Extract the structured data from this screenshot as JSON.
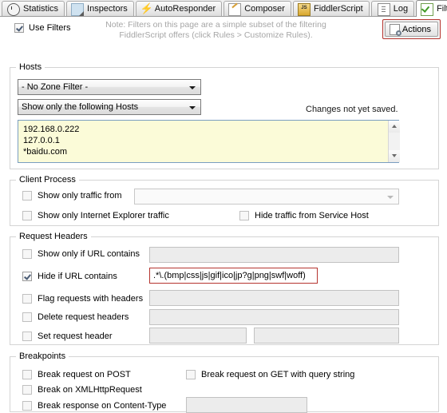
{
  "tabs": [
    {
      "label": "Statistics",
      "icon": "stopwatch-icon",
      "active": false
    },
    {
      "label": "Inspectors",
      "icon": "inspectors-icon",
      "active": false
    },
    {
      "label": "AutoResponder",
      "icon": "lightning-icon",
      "active": false
    },
    {
      "label": "Composer",
      "icon": "compose-icon",
      "active": false
    },
    {
      "label": "FiddlerScript",
      "icon": "js-script-icon",
      "active": false
    },
    {
      "label": "Log",
      "icon": "log-icon",
      "active": false
    },
    {
      "label": "Filters",
      "icon": "filter-check-icon",
      "active": true
    }
  ],
  "toolbar": {
    "use_filters_label": "Use Filters",
    "use_filters_checked": true,
    "note_line1": "Note: Filters on this page are a simple subset of the filtering",
    "note_line2": "FiddlerScript offers (click Rules > Customize Rules).",
    "actions_label": "Actions"
  },
  "hosts": {
    "legend": "Hosts",
    "zone_filter_value": "- No Zone Filter -",
    "host_mode_value": "Show only the following Hosts",
    "host_list": "192.168.0.222\n127.0.0.1\n*baidu.com",
    "status_text": "Changes not yet saved."
  },
  "client_process": {
    "legend": "Client Process",
    "show_only_traffic_from_label": "Show only traffic from",
    "show_only_traffic_from_checked": false,
    "process_value": "",
    "show_only_ie_label": "Show only Internet Explorer traffic",
    "show_only_ie_checked": false,
    "hide_service_host_label": "Hide traffic from Service Host",
    "hide_service_host_checked": false
  },
  "request_headers": {
    "legend": "Request Headers",
    "rows": [
      {
        "label": "Show only if URL contains",
        "checked": false,
        "value": ""
      },
      {
        "label": "Hide if URL contains",
        "checked": true,
        "value": ".*\\.(bmp|css|js|gif|ico|jp?g|png|swf|woff)"
      },
      {
        "label": "Flag requests with headers",
        "checked": false,
        "value": ""
      },
      {
        "label": "Delete request headers",
        "checked": false,
        "value": ""
      },
      {
        "label": "Set request header",
        "checked": false,
        "value": "",
        "value2": ""
      }
    ]
  },
  "breakpoints": {
    "legend": "Breakpoints",
    "break_post_label": "Break request on POST",
    "break_post_checked": false,
    "break_get_label": "Break request on GET with query string",
    "break_get_checked": false,
    "break_xhr_label": "Break on XMLHttpRequest",
    "break_xhr_checked": false,
    "break_response_label": "Break response on Content-Type",
    "break_response_checked": false,
    "break_response_value": ""
  },
  "colors": {
    "accent_red": "#b5342f",
    "host_list_bg": "#fbfbd8",
    "note_gray": "#a6a6a6",
    "tab_active_bg": "#ffffff"
  }
}
